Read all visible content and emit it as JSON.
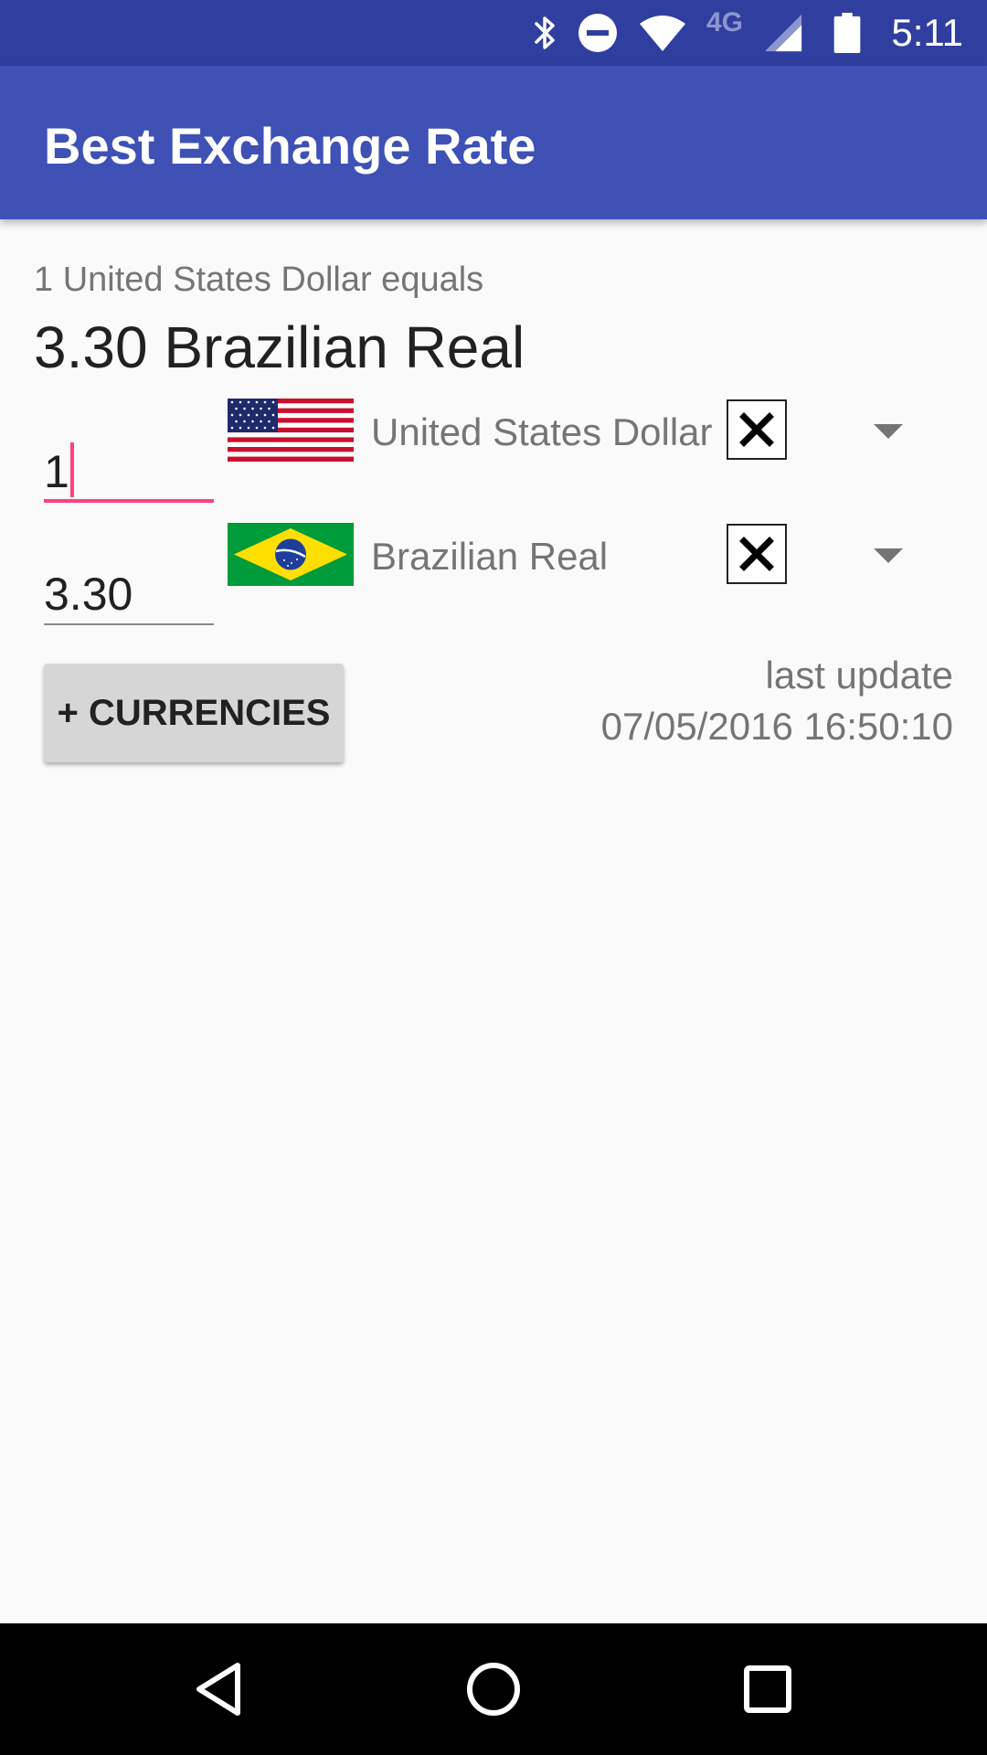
{
  "status_bar": {
    "time": "5:11",
    "network_type": "4G",
    "icons": [
      "bluetooth-icon",
      "do-not-disturb-icon",
      "wifi-icon",
      "cell-signal-icon",
      "battery-icon"
    ],
    "background_color": "#303f9f"
  },
  "app_bar": {
    "title": "Best Exchange Rate",
    "background_color": "#3f51b5"
  },
  "conversion": {
    "caption": "1 United States Dollar equals",
    "result": "3.30 Brazilian Real"
  },
  "currencies": [
    {
      "amount": "1",
      "name": "United States Dollar",
      "flag_icon": "us-flag-icon",
      "focused": true
    },
    {
      "amount": "3.30",
      "name": "Brazilian Real",
      "flag_icon": "brazil-flag-icon",
      "focused": false
    }
  ],
  "add_currencies_button": {
    "label": "+ CURRENCIES"
  },
  "last_update": {
    "label": "last update",
    "timestamp": "07/05/2016 16:50:10"
  },
  "nav_bar": {
    "buttons": [
      "back-icon",
      "home-icon",
      "recents-icon"
    ]
  },
  "colors": {
    "accent": "#ff4081",
    "primary": "#3f51b5",
    "primary_dark": "#303f9f"
  }
}
